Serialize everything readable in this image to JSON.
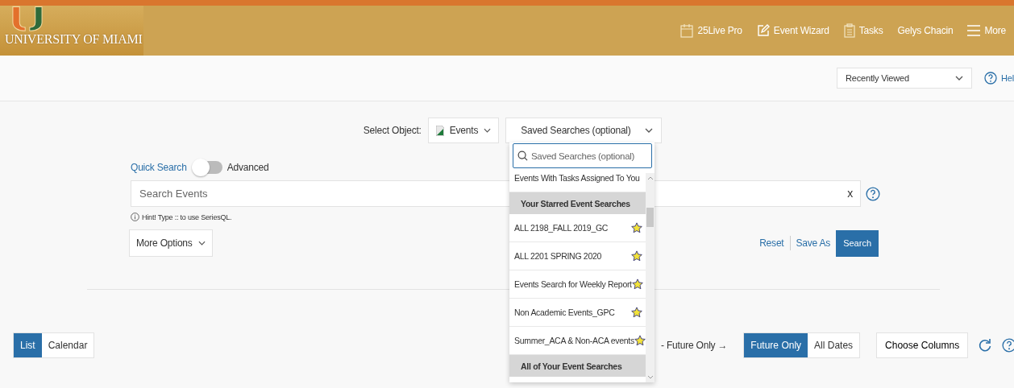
{
  "header": {
    "logo_text": "UNIVERSITY OF MIAMI",
    "nav": [
      {
        "label": "25Live Pro",
        "kind": "calendar"
      },
      {
        "label": "Event Wizard",
        "kind": "edit"
      },
      {
        "label": "Tasks",
        "kind": "clipboard"
      },
      {
        "label": "Gelys Chacin",
        "kind": "none"
      },
      {
        "label": "More",
        "kind": "menu"
      }
    ]
  },
  "subbar": {
    "recent": "Recently Viewed",
    "help": "Hel"
  },
  "select_object": {
    "label": "Select Object:",
    "object": "Events",
    "saved": "Saved Searches (optional)"
  },
  "search": {
    "quick": "Quick Search",
    "advanced": "Advanced",
    "advanced_on": false,
    "placeholder": "Search Events",
    "clear": "x",
    "hint": "Hint! Type :: to use SeriesQL.",
    "more": "More Options",
    "reset": "Reset",
    "save_as": "Save As",
    "search": "Search"
  },
  "dropdown": {
    "placeholder": "Saved Searches (optional)",
    "items": [
      {
        "kind": "option",
        "label": "Events With Tasks Assigned To You",
        "starred": false
      },
      {
        "kind": "header",
        "label": "Your Starred Event Searches"
      },
      {
        "kind": "option",
        "label": "ALL 2198_FALL 2019_GC",
        "starred": true
      },
      {
        "kind": "option",
        "label": "ALL 2201 SPRING 2020",
        "starred": true
      },
      {
        "kind": "option",
        "label": "Events Search for Weekly Report",
        "starred": true
      },
      {
        "kind": "option",
        "label": "Non Academic Events_GPC",
        "starred": true
      },
      {
        "kind": "option",
        "label": "Summer_ACA & Non-ACA events",
        "starred": true
      },
      {
        "kind": "header",
        "label": "All of Your Event Searches"
      }
    ]
  },
  "results": {
    "views": [
      {
        "label": "List",
        "selected": true
      },
      {
        "label": "Calendar",
        "selected": false
      }
    ],
    "future_label": "- Future Only →",
    "dates": [
      {
        "label": "Future Only",
        "selected": true
      },
      {
        "label": "All Dates",
        "selected": false
      }
    ],
    "choose_columns": "Choose Columns"
  }
}
